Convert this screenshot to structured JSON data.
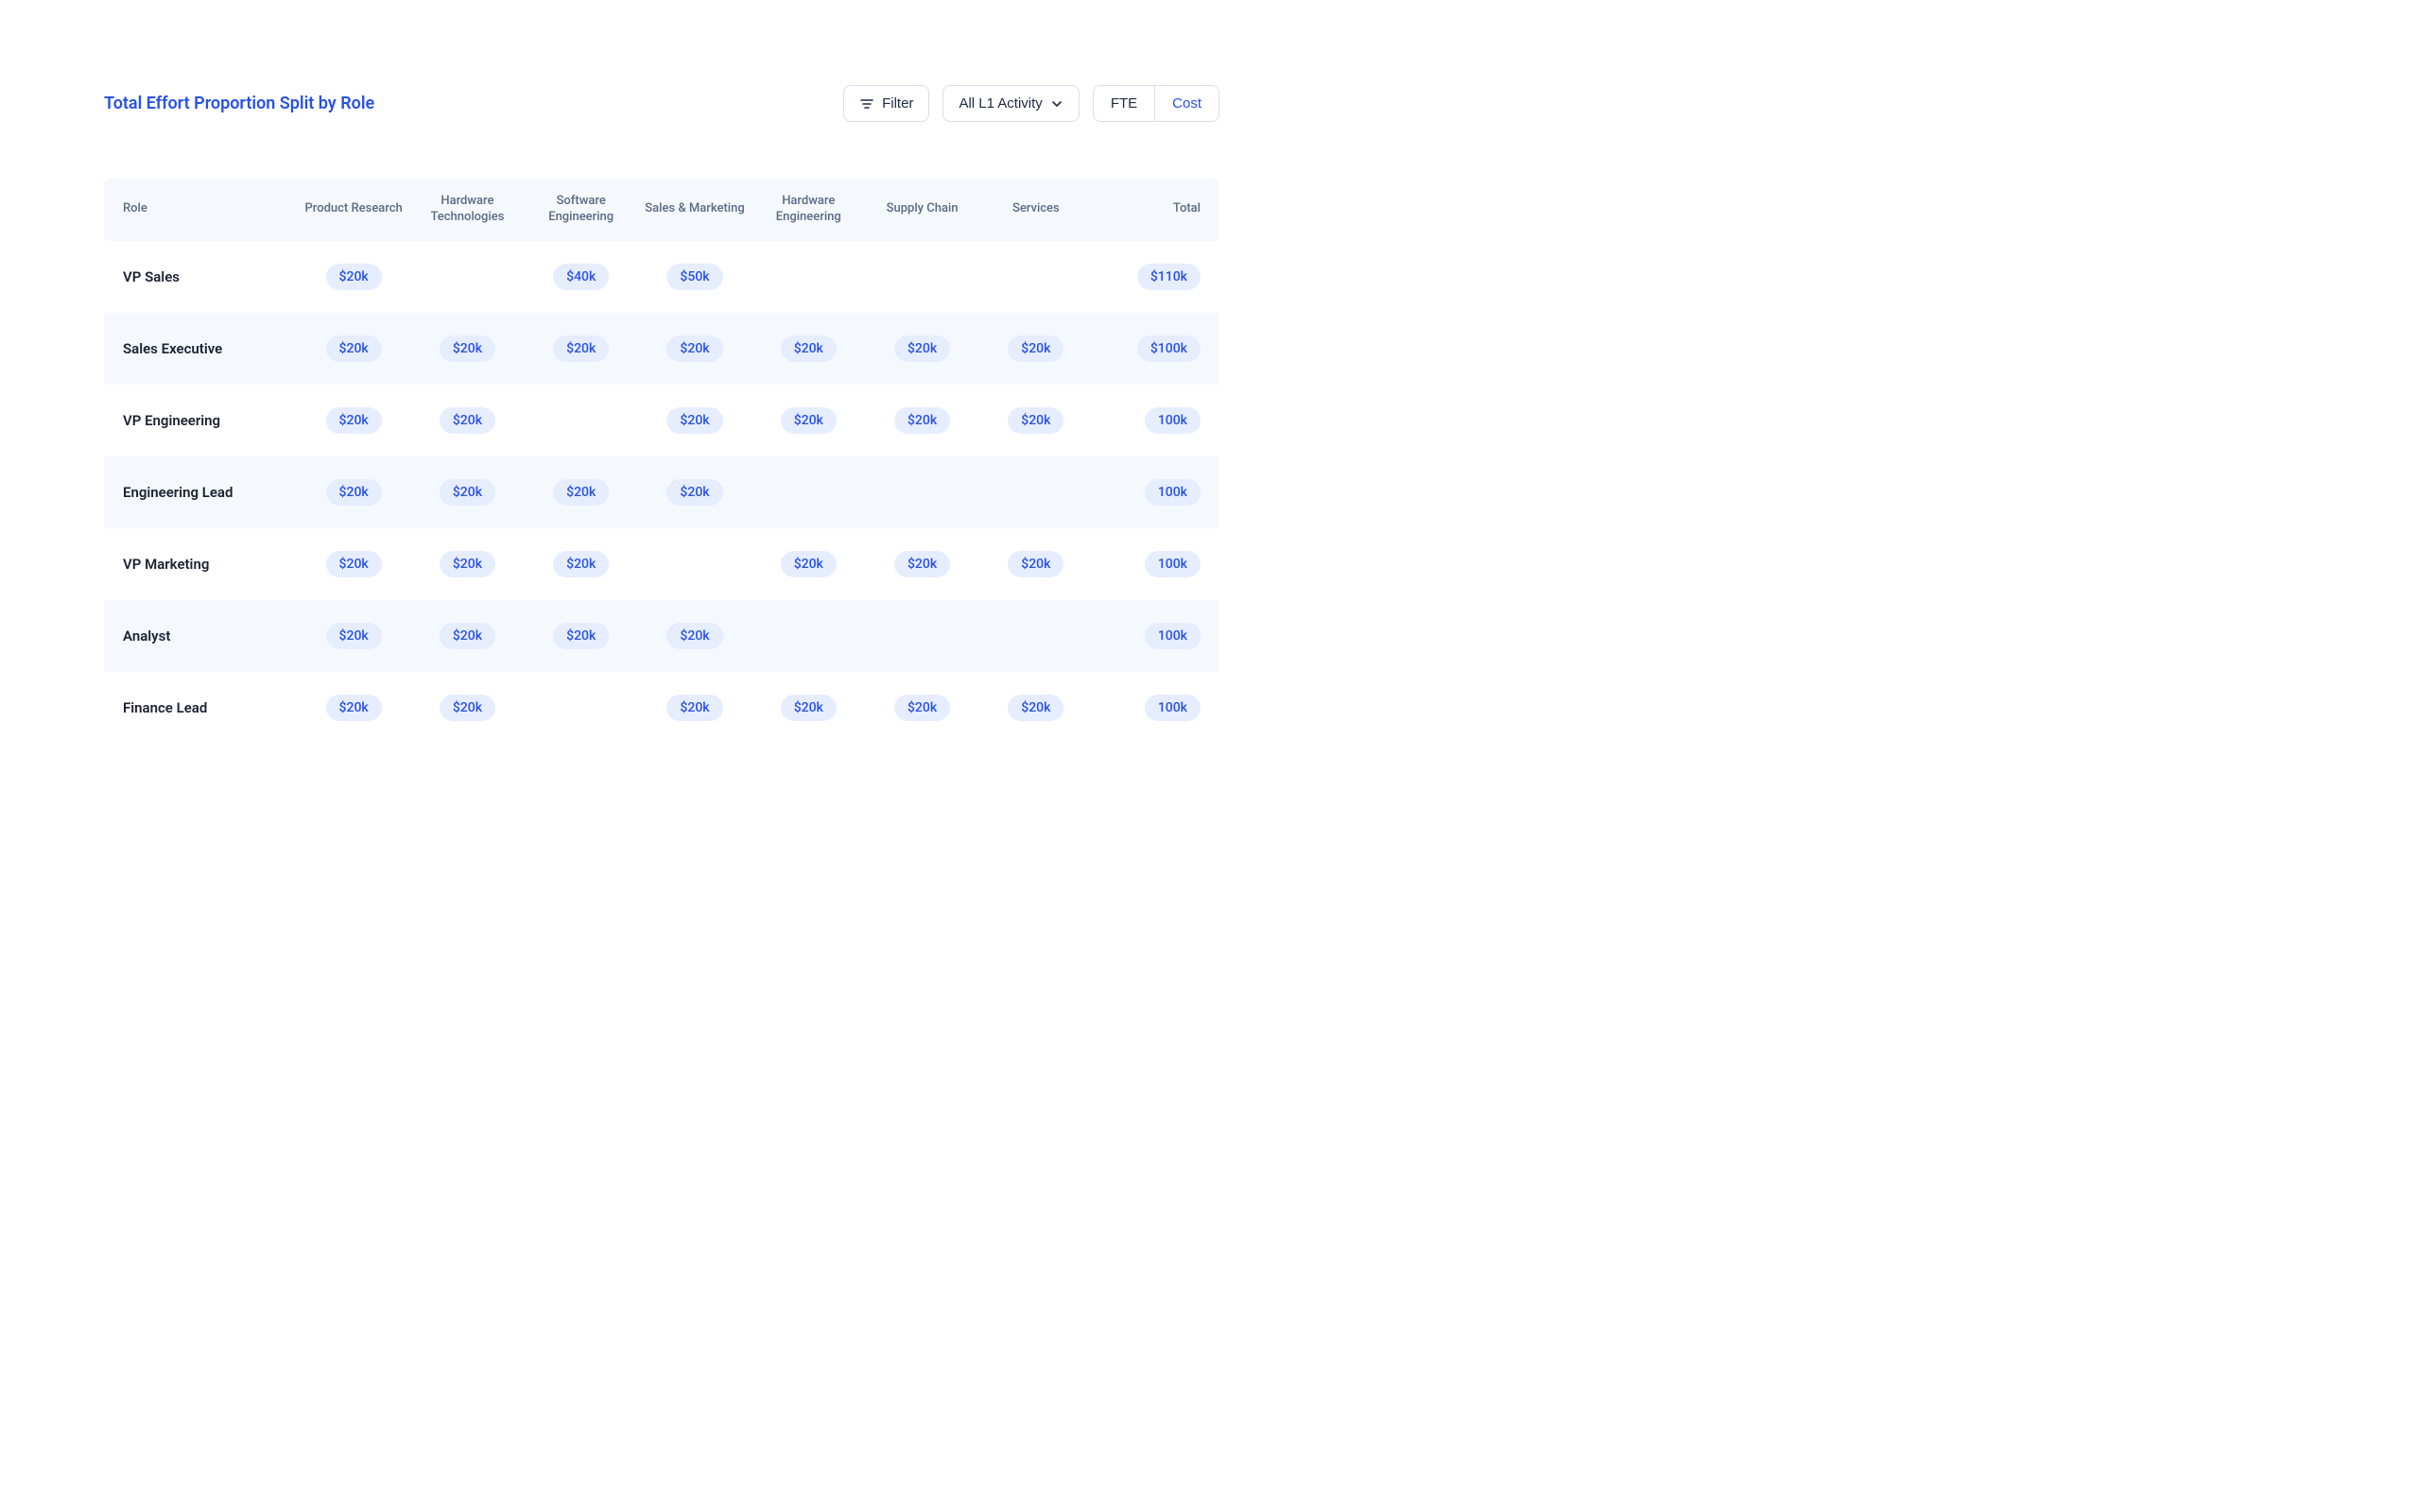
{
  "header": {
    "title": "Total Effort Proportion Split by Role",
    "filter_label": "Filter",
    "activity_label": "All L1 Activity",
    "toggle_fte": "FTE",
    "toggle_cost": "Cost"
  },
  "table": {
    "columns": [
      "Role",
      "Product Research",
      "Hardware Technologies",
      "Software Engineering",
      "Sales & Marketing",
      "Hardware Engineering",
      "Supply Chain",
      "Services",
      "Total"
    ],
    "rows": [
      {
        "role": "VP Sales",
        "cells": [
          "$20k",
          "",
          "$40k",
          "$50k",
          "",
          "",
          ""
        ],
        "total": "$110k"
      },
      {
        "role": "Sales Executive",
        "cells": [
          "$20k",
          "$20k",
          "$20k",
          "$20k",
          "$20k",
          "$20k",
          "$20k"
        ],
        "total": "$100k"
      },
      {
        "role": "VP Engineering",
        "cells": [
          "$20k",
          "$20k",
          "",
          "$20k",
          "$20k",
          "$20k",
          "$20k"
        ],
        "total": "100k"
      },
      {
        "role": "Engineering Lead",
        "cells": [
          "$20k",
          "$20k",
          "$20k",
          "$20k",
          "",
          "",
          ""
        ],
        "total": "100k"
      },
      {
        "role": "VP Marketing",
        "cells": [
          "$20k",
          "$20k",
          "$20k",
          "",
          "$20k",
          "$20k",
          "$20k"
        ],
        "total": "100k"
      },
      {
        "role": "Analyst",
        "cells": [
          "$20k",
          "$20k",
          "$20k",
          "$20k",
          "",
          "",
          ""
        ],
        "total": "100k"
      },
      {
        "role": "Finance Lead",
        "cells": [
          "$20k",
          "$20k",
          "",
          "$20k",
          "$20k",
          "$20k",
          "$20k"
        ],
        "total": "100k"
      }
    ]
  }
}
